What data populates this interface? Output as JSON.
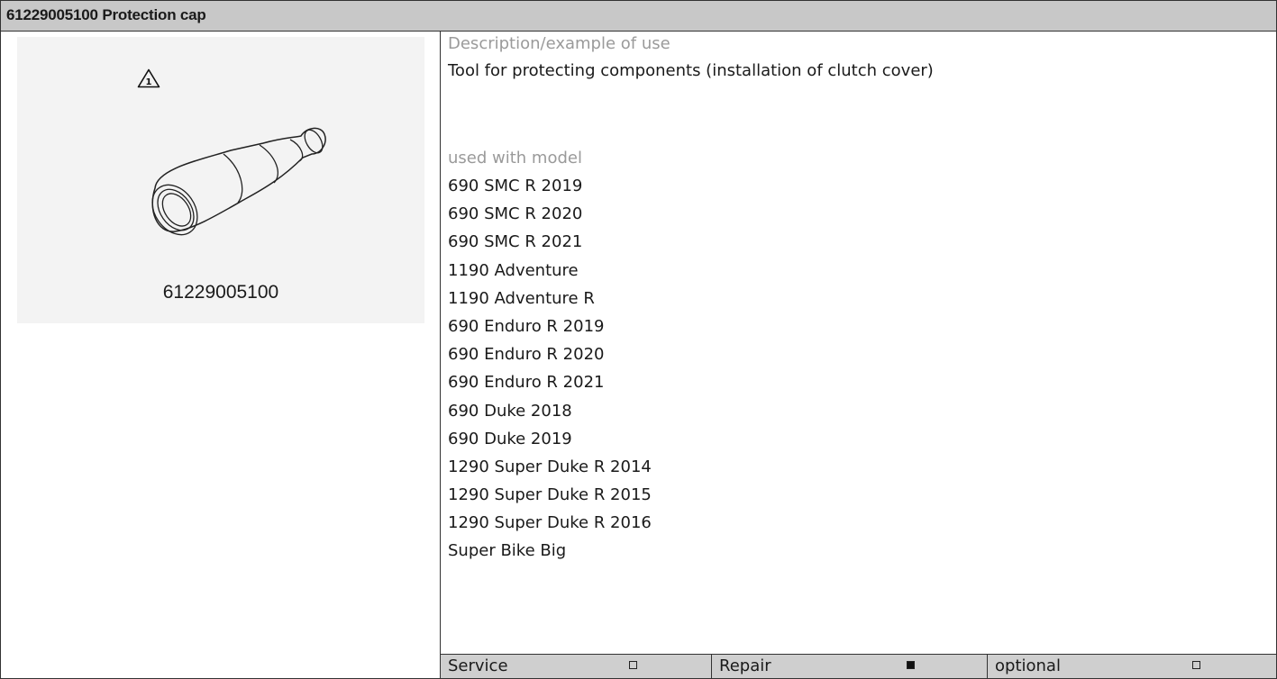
{
  "header": {
    "title": "61229005100 Protection cap"
  },
  "figure": {
    "warning_icon": "warning-triangle-1-icon",
    "warning_number": "1",
    "part_number": "61229005100"
  },
  "description": {
    "label": "Description/example of use",
    "text": "Tool for protecting components (installation of clutch cover)"
  },
  "models": {
    "label": "used with model",
    "items": [
      "690 SMC R 2019",
      "690 SMC R 2020",
      "690 SMC R 2021",
      "1190 Adventure",
      "1190 Adventure R",
      "690 Enduro R 2019",
      "690 Enduro R 2020",
      "690 Enduro R 2021",
      "690 Duke 2018",
      "690 Duke 2019",
      "1290 Super Duke R 2014",
      "1290 Super Duke R 2015",
      "1290 Super Duke R 2016",
      "Super Bike Big"
    ]
  },
  "usage": {
    "service": {
      "label": "Service",
      "checked": false
    },
    "repair": {
      "label": "Repair",
      "checked": true
    },
    "optional": {
      "label": "optional",
      "checked": false
    }
  },
  "colors": {
    "header_bg": "#c8c8c8",
    "label_gray": "#9a9a9a",
    "footer_bg": "#cfcfcf",
    "image_bg": "#f3f3f3"
  }
}
